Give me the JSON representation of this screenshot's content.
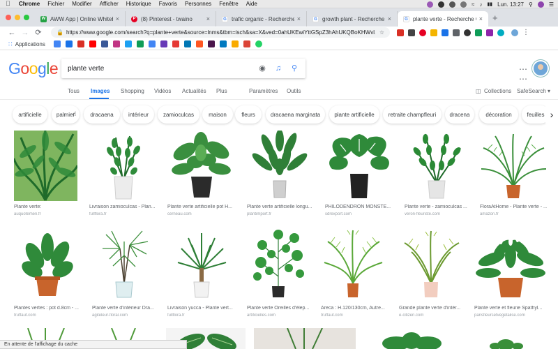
{
  "menubar": {
    "items": [
      "Chrome",
      "Fichier",
      "Modifier",
      "Afficher",
      "Historique",
      "Favoris",
      "Personnes",
      "Fenêtre",
      "Aide"
    ],
    "clock": "Lun. 13:27"
  },
  "tabs": [
    {
      "title": "AWW App | Online Whiteboard",
      "color": "#25a244",
      "glyph": "W"
    },
    {
      "title": "(8) Pinterest - twaino",
      "color": "#e60023",
      "glyph": "P"
    },
    {
      "title": "trafic organic - Recherche Goo",
      "color": "#4285f4",
      "glyph": "G"
    },
    {
      "title": "growth plant - Recherche Goo",
      "color": "#4285f4",
      "glyph": "G"
    },
    {
      "title": "plante verte - Recherche Goo",
      "color": "#4285f4",
      "glyph": "G"
    }
  ],
  "toolbar": {
    "url": "https://www.google.com/search?q=plante+verte&source=lnms&tbm=isch&sa=X&ved=0ahUKEwiYttGSpZ3hAhUKQBoKHWvl..."
  },
  "bookmarks": {
    "apps_label": "Applications"
  },
  "google": {
    "logo": [
      "G",
      "o",
      "o",
      "g",
      "l",
      "e"
    ],
    "logo_colors": [
      "#4285f4",
      "#ea4335",
      "#fbbc05",
      "#4285f4",
      "#34a853",
      "#ea4335"
    ],
    "query": "plante verte"
  },
  "nav": {
    "tabs": [
      "Tous",
      "Images",
      "Shopping",
      "Vidéos",
      "Actualités",
      "Plus"
    ],
    "params": "Paramètres",
    "tools": "Outils",
    "collections": "Collections",
    "safesearch": "SafeSearch ▾"
  },
  "chips": [
    "artificielle",
    "palmier",
    "dracaena",
    "intérieur",
    "zamioculcas",
    "maison",
    "fleurs",
    "dracaena marginata",
    "plante artificielle",
    "retraite champfleuri",
    "dracena",
    "décoration",
    "feuilles"
  ],
  "results": [
    {
      "caption": "Plante verte:",
      "source": "auquotemen.fr"
    },
    {
      "caption": "Livraison zamioculcas - Plan...",
      "source": "fullflora.fr"
    },
    {
      "caption": "Plante verte artificielle pot H...",
      "source": "cerneau.com"
    },
    {
      "caption": "Plante verte artificielle longu...",
      "source": "plantimport.fr"
    },
    {
      "caption": "PHILODENDRON MONSTE...",
      "source": "sdrexport.com"
    },
    {
      "caption": "Plante verte - zamioculcas ...",
      "source": "veron-fleuriste.com"
    },
    {
      "caption": "FloraAtHome - Plante verte - ...",
      "source": "amazon.fr"
    },
    {
      "caption": "Plantes vertes : pot d.8cm - ...",
      "source": "truffaut.com"
    },
    {
      "caption": "Plante verte d'intérieur Dra...",
      "source": "agiteleur-floral.com"
    },
    {
      "caption": "Livraison yucca - Plante vert...",
      "source": "fullflora.fr"
    },
    {
      "caption": "Plante verte Oreilles d'élep...",
      "source": "artificielles.com"
    },
    {
      "caption": "Areca : H.120/130cm, Autre...",
      "source": "truffaut.com"
    },
    {
      "caption": "Grande plante verte d'intér...",
      "source": "e-citizen.com"
    },
    {
      "caption": "Plante verte et fleurie Spathyl...",
      "source": "parisfleursetvegetalise.com"
    }
  ],
  "status": "En attente de l'affichage du cache",
  "colors": {
    "accent": "#1a73e8",
    "plant": "#2e8b3a",
    "pot_dark": "#2b2b2b",
    "pot_terracotta": "#c8642c",
    "pot_white": "#e6e6e6"
  }
}
